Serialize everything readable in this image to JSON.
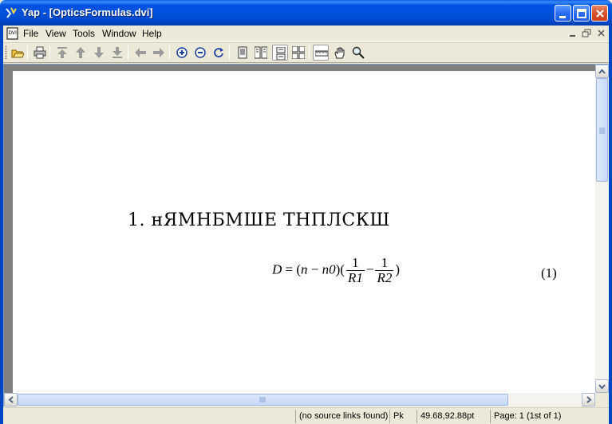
{
  "window": {
    "title": "Yap - [OpticsFormulas.dvi]"
  },
  "menu": {
    "items": [
      "File",
      "View",
      "Tools",
      "Window",
      "Help"
    ]
  },
  "toolbar": {
    "buttons": [
      "open-icon",
      "print-icon",
      "first-page-icon",
      "previous-page-icon",
      "next-page-icon",
      "last-page-icon",
      "back-icon",
      "forward-icon",
      "zoom-in-icon",
      "zoom-out-icon",
      "refresh-icon",
      "single-page-icon",
      "double-page-icon",
      "continuous-single-icon",
      "continuous-double-icon",
      "ruler-icon",
      "hand-tool-icon",
      "magnifier-icon"
    ]
  },
  "document": {
    "heading_number": "1.",
    "heading_text": "нЯМНБМШЕ ТНПЛСКШ",
    "formula": {
      "lhs": "D",
      "eq": "=",
      "open": "(",
      "n": "n",
      "minus1": "−",
      "n0": "n0",
      "close": ")(",
      "frac1_num": "1",
      "frac1_den": "R1",
      "minus2": "−",
      "frac2_num": "1",
      "frac2_den": "R2",
      "end": ")"
    },
    "equation_number": "(1)"
  },
  "status": {
    "source_links": "(no source links found)",
    "font_mode": "Pk",
    "coordinates": "49.68,92.88pt",
    "page": "Page: 1 (1st of 1)"
  },
  "colors": {
    "titlebar": "#0054e3",
    "close_button": "#d9532a",
    "chrome": "#ece9d8",
    "workspace": "#808080"
  }
}
